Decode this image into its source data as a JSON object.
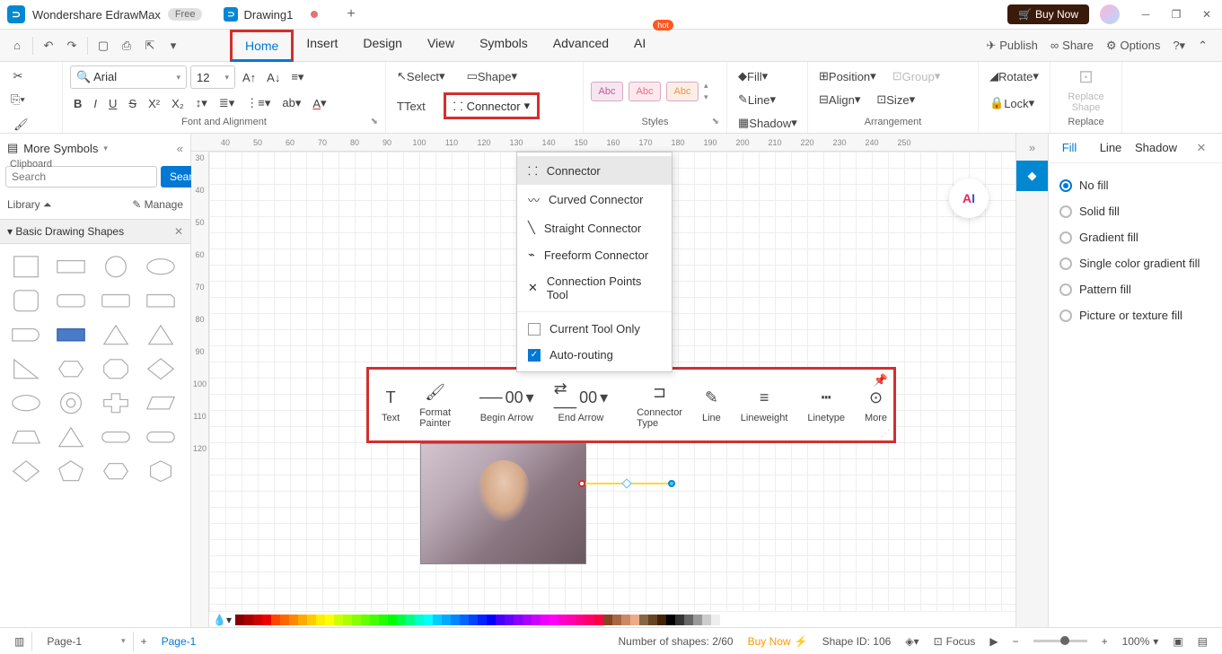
{
  "titlebar": {
    "app_name": "Wondershare EdrawMax",
    "badge": "Free",
    "tab_name": "Drawing1",
    "buy": "Buy Now"
  },
  "menus": {
    "items": [
      "Home",
      "Insert",
      "Design",
      "View",
      "Symbols",
      "Advanced",
      "AI"
    ],
    "hot": "hot",
    "right": {
      "publish": "Publish",
      "share": "Share",
      "options": "Options"
    }
  },
  "ribbon": {
    "clipboard": "Clipboard",
    "font_alignment": "Font and Alignment",
    "font": "Arial",
    "size": "12",
    "select": "Select",
    "shape": "Shape",
    "text": "Text",
    "connector": "Connector",
    "styles": "Styles",
    "style_label": "Abc",
    "fill": "Fill",
    "line": "Line",
    "shadow": "Shadow",
    "position": "Position",
    "align": "Align",
    "group": "Group",
    "size_btn": "Size",
    "rotate": "Rotate",
    "lock": "Lock",
    "arrangement": "Arrangement",
    "replace_shape": "Replace\nShape",
    "replace": "Replace"
  },
  "connector_menu": {
    "items": [
      "Connector",
      "Curved Connector",
      "Straight Connector",
      "Freeform Connector",
      "Connection Points Tool"
    ],
    "current_only": "Current Tool Only",
    "auto_routing": "Auto-routing"
  },
  "float_toolbar": {
    "text": "Text",
    "format_painter": "Format\nPainter",
    "begin_arrow": "Begin Arrow",
    "end_arrow": "End Arrow",
    "arrow_val": "00",
    "connector_type": "Connector\nType",
    "line": "Line",
    "lineweight": "Lineweight",
    "linetype": "Linetype",
    "more": "More"
  },
  "left_panel": {
    "title": "More Symbols",
    "search_placeholder": "Search",
    "search_btn": "Search",
    "library": "Library",
    "manage": "Manage",
    "section": "Basic Drawing Shapes"
  },
  "right_panel": {
    "tabs": [
      "Fill",
      "Line",
      "Shadow"
    ],
    "options": [
      "No fill",
      "Solid fill",
      "Gradient fill",
      "Single color gradient fill",
      "Pattern fill",
      "Picture or texture fill"
    ]
  },
  "ruler_h": [
    "40",
    "50",
    "60",
    "70",
    "80",
    "90",
    "100",
    "110",
    "120",
    "130",
    "140",
    "150",
    "160",
    "170",
    "180",
    "190",
    "200",
    "210",
    "220",
    "230",
    "240",
    "250"
  ],
  "ruler_v": [
    "30",
    "40",
    "50",
    "60",
    "70",
    "80",
    "90",
    "100",
    "110",
    "120"
  ],
  "statusbar": {
    "page": "Page-1",
    "page_tab": "Page-1",
    "shapes": "Number of shapes: 2/60",
    "buy": "Buy Now",
    "shape_id": "Shape ID: 106",
    "focus": "Focus",
    "zoom": "100%"
  }
}
